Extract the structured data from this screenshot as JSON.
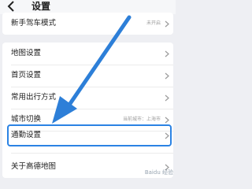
{
  "header": {
    "title": "设置",
    "back_icon": "chevron-left-icon"
  },
  "card1": {
    "row": {
      "label": "新手驾车模式",
      "value": "未开启"
    }
  },
  "card2": {
    "rows": [
      {
        "label": "地图设置",
        "value": ""
      },
      {
        "label": "首页设置",
        "value": ""
      },
      {
        "label": "常用出行方式",
        "value": ""
      },
      {
        "label": "城市切换",
        "value": "当前城市：上海市"
      },
      {
        "label": "通勤设置",
        "value": ""
      },
      {
        "label": "关于高德地图",
        "value": ""
      }
    ]
  },
  "highlight_color": "#2b83e4",
  "watermark": "Baidu 经验"
}
